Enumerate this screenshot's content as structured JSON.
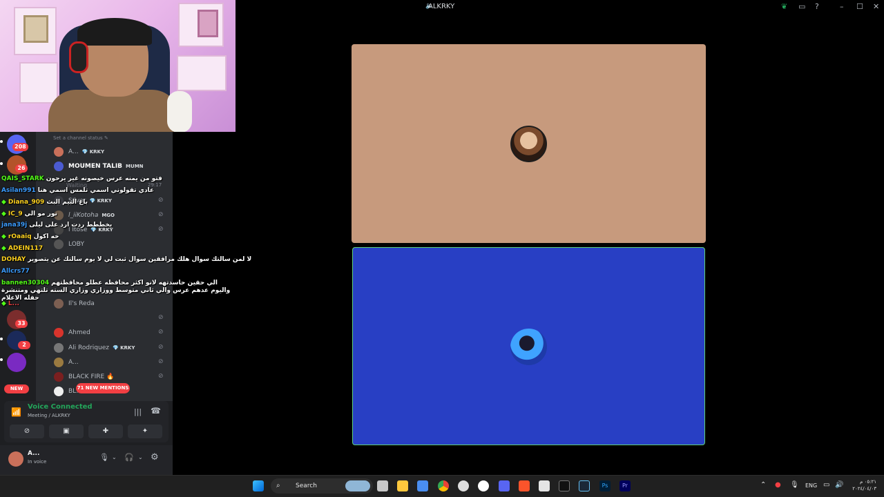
{
  "window": {
    "title": "ALKRKY",
    "title_icon": "speaker-icon"
  },
  "channel": {
    "status_prompt": "Set a channel status ✎"
  },
  "members": [
    {
      "name": "A...",
      "tag": "💎 KRKY"
    },
    {
      "name": "MOUMEN TALIB",
      "tag": "MUMN"
    },
    {
      "name": "Waiting",
      "tag": ""
    },
    {
      "name": "SIlver",
      "tag": "💎 KRKY"
    },
    {
      "name": "l_iiKotoha",
      "tag": "MGO"
    },
    {
      "name": "l Itose",
      "tag": "💎 KRKY"
    },
    {
      "name": "LOBY",
      "tag": ""
    },
    {
      "name": "Il's Reda",
      "tag": ""
    },
    {
      "name": "Ahmed",
      "tag": ""
    },
    {
      "name": "Ali Rodriquez",
      "tag": "💎 KRKY"
    },
    {
      "name": "A...",
      "tag": ""
    },
    {
      "name": "BLACK FIRE 🔥",
      "tag": ""
    },
    {
      "name": "BL...",
      "tag": ""
    }
  ],
  "timestamp": "29:17",
  "guild_badges": {
    "b1": "208",
    "b2": "26",
    "b3": "2",
    "b4": "33",
    "b5": "2",
    "new": "NEW"
  },
  "chat": [
    {
      "user": "QAIS_STARK",
      "text": "فتو من يمنه عرس خيصونه غير يرحون",
      "color": "#53fc18"
    },
    {
      "user": "Asilan991",
      "text": "عادي تقولوني اسمي تلمس اسمي هنا",
      "color": "#3b9cff"
    },
    {
      "user": "Diana_909",
      "text": "باع البيم البث",
      "color": "#ffd21f"
    },
    {
      "user": "IC_9",
      "text": "نور مو الي",
      "color": "#ffd21f"
    },
    {
      "user": "jana39j",
      "text": "يخططط ردت ارد على ليلى",
      "color": "#3b9cff"
    },
    {
      "user": "rOaaiq",
      "text": "خه اكول",
      "color": "#ffd21f"
    },
    {
      "user": "ADEIN117",
      "text": "",
      "color": "#ffd21f"
    },
    {
      "user": "DOHAY",
      "text": "لا لمن سالتك سوال هلك مرافقين سوال ثبت لي لا يوم سالتك عن يتصوير",
      "color": "#ffd21f"
    },
    {
      "user": "Allcrs77",
      "text": "",
      "color": "#3b9cff"
    },
    {
      "user": "bannen30304",
      "text": "الي حقين حاسدتهه لانو اكثر محافظه عطلو محافظتهم واليوم عدهم عرس والي ثاني متوسط ووزاري وزاري السته تلتهي ومتنشرة حفله الاعلام",
      "color": "#53fc18"
    },
    {
      "user": "L...",
      "text": "",
      "color": "#f23f43"
    }
  ],
  "mentions_label": "71 NEW MENTIONS",
  "voice": {
    "status": "Voice Connected",
    "location": "Meeting / ALKRKY"
  },
  "user": {
    "name": "A...",
    "status": "In voice"
  },
  "taskbar": {
    "search_label": "Search",
    "language": "ENG",
    "time": "٠٥:٢١ م",
    "date": "٢٠٢٤/٠٤/٠٣"
  }
}
